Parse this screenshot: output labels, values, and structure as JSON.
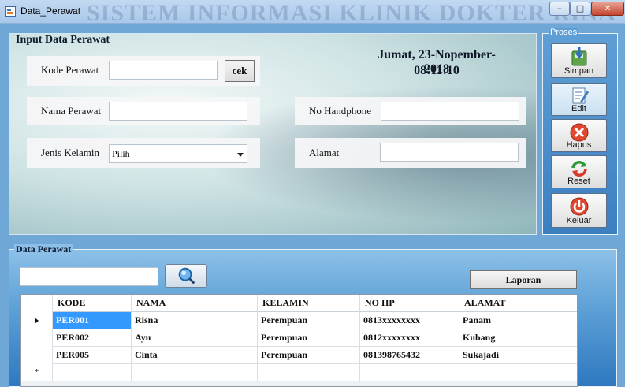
{
  "window": {
    "title": "Data_Perawat",
    "watermark": "SISTEM INFORMASI KLINIK DOKTER RINA",
    "min_glyph": "–",
    "max_glyph": "□",
    "close_glyph": "✕"
  },
  "input_panel": {
    "title": "Input Data Perawat",
    "date": "Jumat, 23-Nopember-2018",
    "time": "08:11:10",
    "kode_label": "Kode Perawat",
    "kode_value": "",
    "cek_label": "cek",
    "nama_label": "Nama Perawat",
    "nama_value": "",
    "jk_label": "Jenis Kelamin",
    "jk_value": "Pilih",
    "hp_label": "No Handphone",
    "hp_value": "",
    "alamat_label": "Alamat",
    "alamat_value": ""
  },
  "proses": {
    "title": "Proses",
    "buttons": [
      {
        "label": "Simpan",
        "icon": "save-icon"
      },
      {
        "label": "Edit",
        "icon": "edit-icon"
      },
      {
        "label": "Hapus",
        "icon": "delete-icon"
      },
      {
        "label": "Reset",
        "icon": "reset-icon"
      },
      {
        "label": "Keluar",
        "icon": "exit-icon"
      }
    ]
  },
  "data_panel": {
    "title": "Data Perawat",
    "search_value": "",
    "laporan_label": "Laporan"
  },
  "grid": {
    "columns": [
      "KODE",
      "NAMA",
      "KELAMIN",
      "NO HP",
      "ALAMAT"
    ],
    "rows": [
      {
        "kode": "PER001",
        "nama": "Risna",
        "kelamin": "Perempuan",
        "hp": "0813xxxxxxxx",
        "alamat": "Panam"
      },
      {
        "kode": "PER002",
        "nama": "Ayu",
        "kelamin": "Perempuan",
        "hp": "0812xxxxxxxx",
        "alamat": "Kubang"
      },
      {
        "kode": "PER005",
        "nama": "Cinta",
        "kelamin": "Perempuan",
        "hp": "081398765432",
        "alamat": "Sukajadi"
      }
    ],
    "new_row_marker": "*"
  },
  "colors": {
    "accent": "#3c7fc0",
    "selected_cell": "#3399ff"
  }
}
